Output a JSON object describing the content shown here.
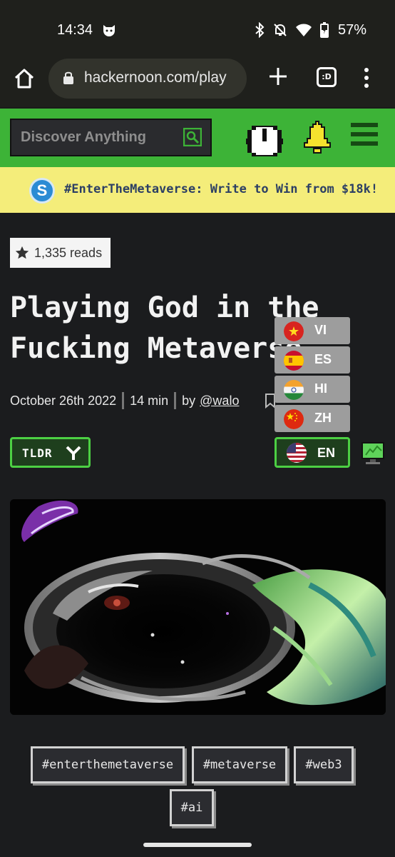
{
  "status_bar": {
    "time": "14:34",
    "battery": "57%",
    "icons": [
      "cat-notification-icon",
      "bluetooth-icon",
      "mute-icon",
      "wifi-icon",
      "battery-icon"
    ]
  },
  "browser": {
    "url": "hackernoon.com/play",
    "tabs_label": ":D",
    "icons": [
      "home-icon",
      "lock-icon",
      "plus-icon",
      "tab-switcher-icon",
      "more-vert-icon"
    ]
  },
  "header": {
    "search_placeholder": "Discover Anything",
    "accent_color": "#3db337",
    "icons": [
      "search-icon",
      "hackernoon-logo",
      "bell-icon",
      "hamburger-icon"
    ]
  },
  "promo": {
    "text": "#EnterTheMetaverse: Write to Win from $18k!",
    "icon_letter": "S",
    "background": "#f4ed7a"
  },
  "article": {
    "reads": "1,335 reads",
    "title_line1": "Playing God in the",
    "title_line2": "Fucking Metaverse",
    "date": "October 26th 2022",
    "read_time": "14 min",
    "by_label": "by",
    "author": "@walo",
    "tldr_label": "TLDR"
  },
  "languages": {
    "options": [
      {
        "code": "VI"
      },
      {
        "code": "ES"
      },
      {
        "code": "HI"
      },
      {
        "code": "ZH"
      }
    ],
    "current": "EN"
  },
  "tags": [
    "#enterthemetaverse",
    "#metaverse",
    "#web3",
    "#ai"
  ]
}
